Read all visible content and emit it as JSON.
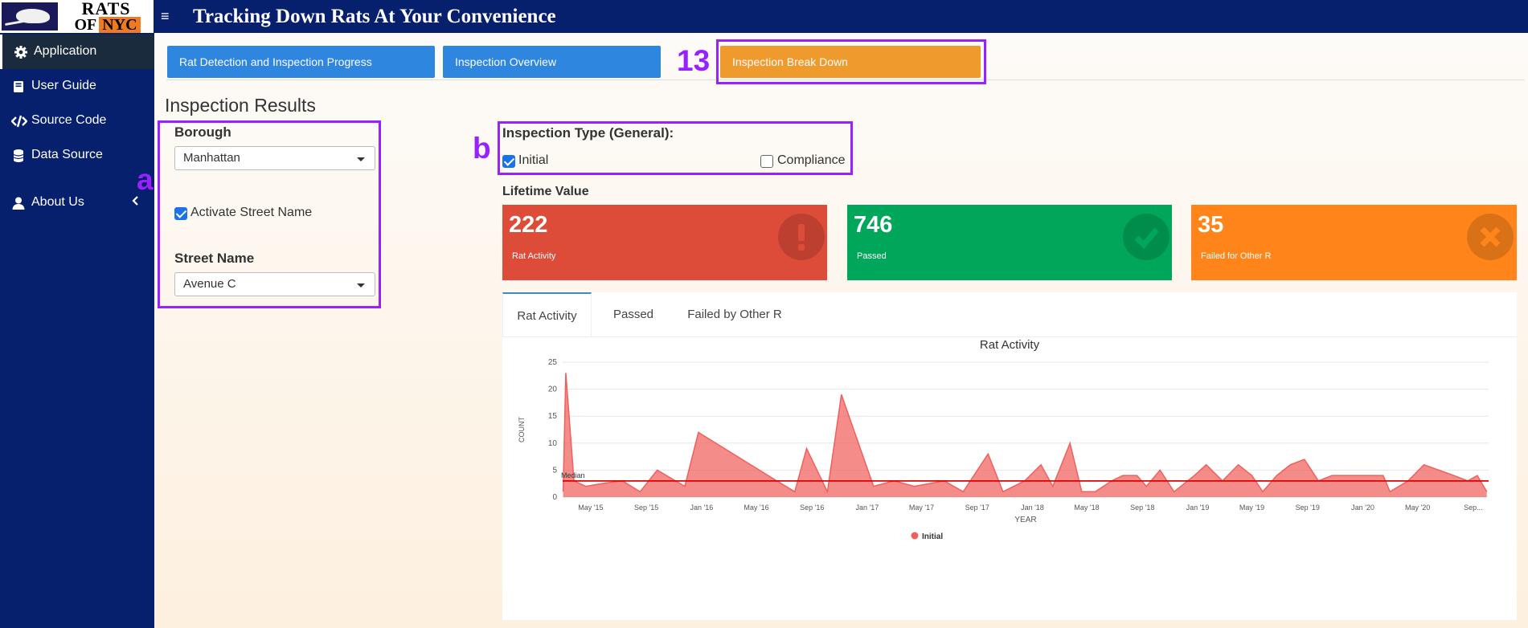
{
  "header": {
    "logo_line1": "RATS",
    "logo_of": "OF",
    "logo_nyc": "NYC",
    "title": "Tracking Down Rats At Your Convenience",
    "menu_icon": "hamburger-icon"
  },
  "sidebar": {
    "items": [
      {
        "label": "Application",
        "icon": "gear-icon",
        "active": true
      },
      {
        "label": "User Guide",
        "icon": "book-icon"
      },
      {
        "label": "Source Code",
        "icon": "code-icon"
      },
      {
        "label": "Data Source",
        "icon": "database-icon"
      },
      {
        "label": "About Us",
        "icon": "user-icon"
      }
    ]
  },
  "tabs": [
    {
      "label": "Rat Detection and Inspection Progress"
    },
    {
      "label": "Inspection Overview"
    },
    {
      "label": "Inspection Break Down",
      "active": true
    }
  ],
  "annotations": {
    "tab": "13",
    "filters": "a",
    "type": "b"
  },
  "filters": {
    "section_title": "Inspection Results",
    "borough_label": "Borough",
    "borough_value": "Manhattan",
    "street_toggle_label": "Activate Street Name",
    "street_toggle_checked": true,
    "street_label": "Street Name",
    "street_value": "Avenue C"
  },
  "inspection_type": {
    "label": "Inspection Type (General):",
    "options": [
      {
        "label": "Initial",
        "checked": true
      },
      {
        "label": "Compliance",
        "checked": false
      }
    ]
  },
  "lifetime": {
    "title": "Lifetime Value",
    "boxes": [
      {
        "value": "222",
        "caption": "Rat Activity",
        "color": "#dd4b39",
        "icon": "exclamation-icon"
      },
      {
        "value": "746",
        "caption": "Passed",
        "color": "#00a65a",
        "icon": "check-icon"
      },
      {
        "value": "35",
        "caption": "Failed for Other R",
        "color": "#ff851b",
        "icon": "x-icon"
      }
    ]
  },
  "chart_tabs": [
    "Rat Activity",
    "Passed",
    "Failed by Other R"
  ],
  "chart_data": {
    "type": "area",
    "title": "Rat Activity",
    "xlabel": "YEAR",
    "ylabel": "COUNT",
    "ylim": [
      0,
      25
    ],
    "yticks": [
      0,
      5,
      10,
      15,
      20,
      25
    ],
    "xlim": [
      "2015-02-28",
      "2020-10-05"
    ],
    "xticks": [
      {
        "label": "May '15",
        "date": "2015-05-01"
      },
      {
        "label": "Sep '15",
        "date": "2015-09-01"
      },
      {
        "label": "Jan '16",
        "date": "2016-01-01"
      },
      {
        "label": "May '16",
        "date": "2016-05-01"
      },
      {
        "label": "Sep '16",
        "date": "2016-09-01"
      },
      {
        "label": "Jan '17",
        "date": "2017-01-01"
      },
      {
        "label": "May '17",
        "date": "2017-05-01"
      },
      {
        "label": "Sep '17",
        "date": "2017-09-01"
      },
      {
        "label": "Jan '18",
        "date": "2018-01-01"
      },
      {
        "label": "May '18",
        "date": "2018-05-01"
      },
      {
        "label": "Sep '18",
        "date": "2018-09-01"
      },
      {
        "label": "Jan '19",
        "date": "2019-01-01"
      },
      {
        "label": "May '19",
        "date": "2019-05-01"
      },
      {
        "label": "Sep '19",
        "date": "2019-09-01"
      },
      {
        "label": "Jan '20",
        "date": "2020-01-01"
      },
      {
        "label": "May '20",
        "date": "2020-05-01"
      },
      {
        "label": "Sep...",
        "date": "2020-09-01"
      }
    ],
    "median": {
      "label": "Median",
      "value": 3
    },
    "grid": true,
    "legend": "bottom-center",
    "series": [
      {
        "name": "Initial",
        "color": "#f0605d",
        "points": [
          [
            "2015-03-01",
            1
          ],
          [
            "2015-03-07",
            23
          ],
          [
            "2015-03-25",
            3
          ],
          [
            "2015-04-20",
            2
          ],
          [
            "2015-05-25",
            2.5
          ],
          [
            "2015-07-10",
            3
          ],
          [
            "2015-08-18",
            1
          ],
          [
            "2015-09-25",
            5
          ],
          [
            "2015-11-25",
            2
          ],
          [
            "2015-12-25",
            12
          ],
          [
            "2016-06-15",
            3
          ],
          [
            "2016-07-25",
            1
          ],
          [
            "2016-08-20",
            9
          ],
          [
            "2016-10-05",
            1
          ],
          [
            "2016-11-05",
            19
          ],
          [
            "2017-01-15",
            2
          ],
          [
            "2017-03-01",
            3
          ],
          [
            "2017-04-15",
            2
          ],
          [
            "2017-06-20",
            3
          ],
          [
            "2017-08-01",
            1
          ],
          [
            "2017-09-25",
            8
          ],
          [
            "2017-10-28",
            1
          ],
          [
            "2017-12-15",
            3
          ],
          [
            "2018-01-20",
            6
          ],
          [
            "2018-02-15",
            2
          ],
          [
            "2018-03-25",
            10
          ],
          [
            "2018-04-20",
            1
          ],
          [
            "2018-05-20",
            1
          ],
          [
            "2018-06-25",
            3
          ],
          [
            "2018-07-20",
            4
          ],
          [
            "2018-08-20",
            4
          ],
          [
            "2018-09-10",
            2
          ],
          [
            "2018-10-10",
            5
          ],
          [
            "2018-11-10",
            1
          ],
          [
            "2018-12-25",
            4
          ],
          [
            "2019-01-20",
            6
          ],
          [
            "2019-02-25",
            3
          ],
          [
            "2019-04-01",
            6
          ],
          [
            "2019-05-01",
            4
          ],
          [
            "2019-05-25",
            1
          ],
          [
            "2019-06-25",
            4
          ],
          [
            "2019-07-25",
            6
          ],
          [
            "2019-08-25",
            7
          ],
          [
            "2019-09-25",
            3
          ],
          [
            "2019-10-25",
            4
          ],
          [
            "2019-12-25",
            4
          ],
          [
            "2020-02-15",
            4
          ],
          [
            "2020-03-01",
            1
          ],
          [
            "2020-04-10",
            3
          ],
          [
            "2020-05-15",
            6
          ],
          [
            "2020-07-20",
            4
          ],
          [
            "2020-08-20",
            3
          ],
          [
            "2020-09-10",
            4
          ],
          [
            "2020-10-01",
            1
          ]
        ]
      }
    ]
  }
}
